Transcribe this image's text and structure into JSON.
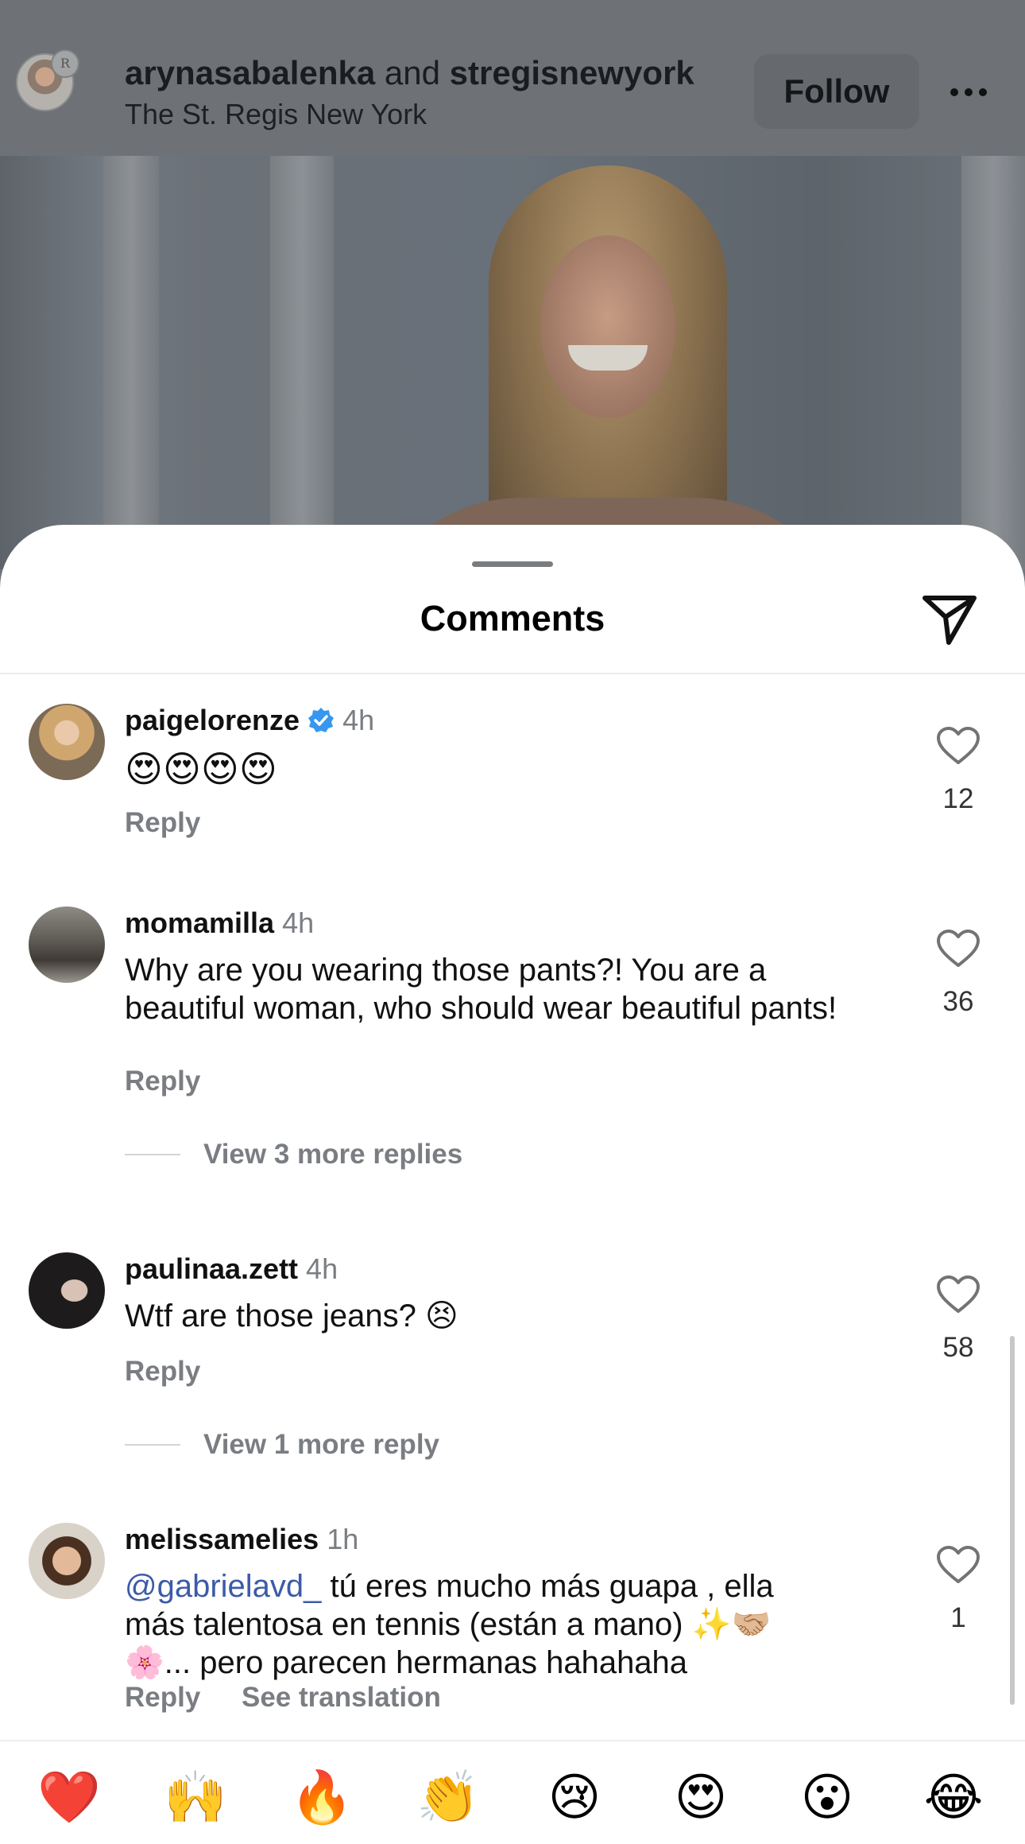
{
  "post": {
    "title_user1": "arynasabalenka",
    "title_and": "and",
    "title_user2": "stregisnewyork",
    "location": "The St. Regis New York",
    "follow_label": "Follow",
    "avatar_small_text": "R"
  },
  "sheet": {
    "title": "Comments"
  },
  "comments": [
    {
      "username": "paigelorenze",
      "verified": true,
      "time": "4h",
      "text": "😍😍😍😍",
      "reply_label": "Reply",
      "likes": "12"
    },
    {
      "username": "momamilla",
      "time": "4h",
      "text": "Why are you wearing those pants?! You are a beautiful woman, who should wear beautiful pants!",
      "reply_label": "Reply",
      "likes": "36",
      "view_more": "View 3 more replies"
    },
    {
      "username": "paulinaa.zett",
      "time": "4h",
      "text": "Wtf are those jeans? 😣",
      "reply_label": "Reply",
      "likes": "58",
      "view_more": "View 1 more reply"
    },
    {
      "username": "melissamelies",
      "time": "1h",
      "mention": "@gabrielavd_",
      "text": " tú eres mucho más guapa , ella más talentosa en tennis (están a mano) ✨🤝🏼 🌸... pero parecen hermanas  hahahaha",
      "reply_label": "Reply",
      "translate_label": "See translation",
      "likes": "1"
    }
  ],
  "emoji_bar": [
    "❤️",
    "🙌",
    "🔥",
    "👏",
    "😢",
    "😍",
    "😮",
    "😂"
  ],
  "colors": {
    "mention": "#3c5ba8",
    "verified": "#3797f0",
    "muted_text": "#7a7d82"
  }
}
